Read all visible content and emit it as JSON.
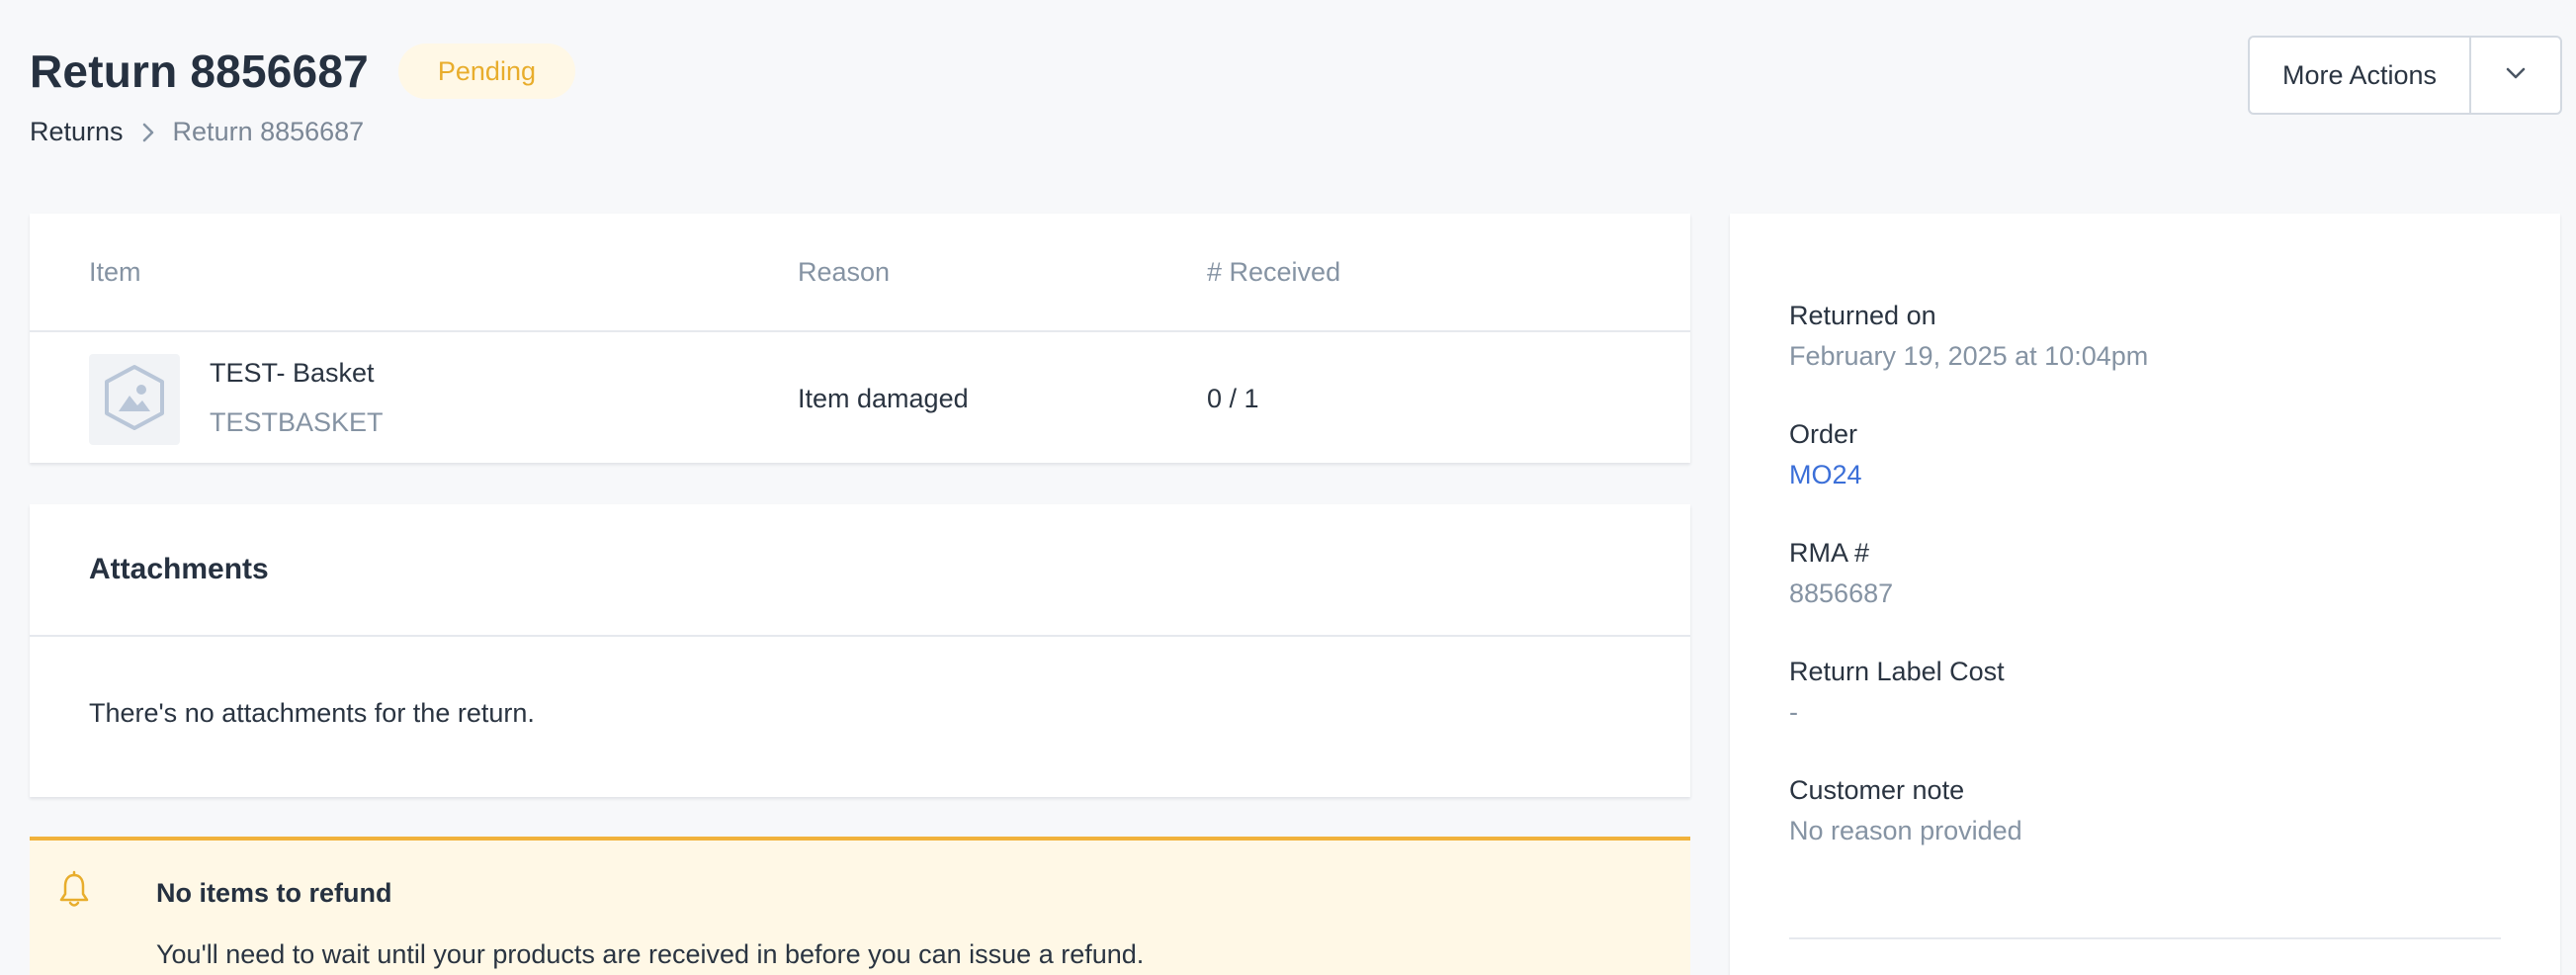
{
  "header": {
    "title": "Return 8856687",
    "status": "Pending",
    "breadcrumb": {
      "parent": "Returns",
      "current": "Return 8856687"
    },
    "more_actions_label": "More Actions"
  },
  "items_table": {
    "columns": {
      "item": "Item",
      "reason": "Reason",
      "received": "# Received"
    },
    "rows": [
      {
        "name": "TEST- Basket",
        "sku": "TESTBASKET",
        "reason": "Item damaged",
        "received": "0 / 1"
      }
    ]
  },
  "attachments": {
    "title": "Attachments",
    "empty_text": "There's no attachments for the return."
  },
  "notice": {
    "title": "No items to refund",
    "text": "You'll need to wait until your products are received in before you can issue a refund."
  },
  "details": {
    "returned_on": {
      "label": "Returned on",
      "value": "February 19, 2025 at 10:04pm"
    },
    "order": {
      "label": "Order",
      "value": "MO24"
    },
    "rma": {
      "label": "RMA #",
      "value": "8856687"
    },
    "return_label_cost": {
      "label": "Return Label Cost",
      "value": "-"
    },
    "customer_note": {
      "label": "Customer note",
      "value": "No reason provided"
    }
  },
  "colors": {
    "status_text": "#e8ad2c",
    "status_bg": "#fff8e6",
    "link": "#3b6fd8",
    "notice_border": "#f1b23b"
  },
  "icons": [
    "chevron-right-icon",
    "chevron-down-icon",
    "image-placeholder-icon",
    "bell-icon"
  ]
}
